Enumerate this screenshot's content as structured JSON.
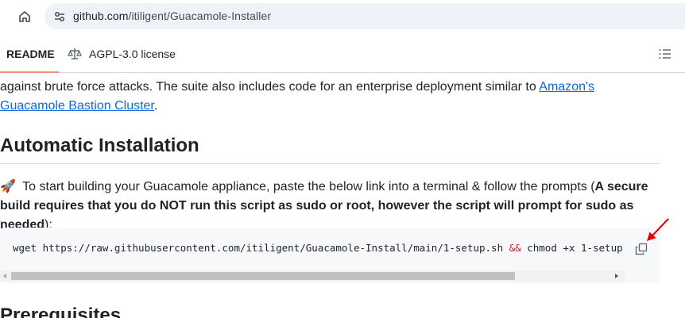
{
  "browser": {
    "url_host": "github.com",
    "url_path": "/itiligent/Guacamole-Installer",
    "home_icon": "home-icon",
    "site_info_icon": "tune-icon"
  },
  "tabs": {
    "readme_label": "README",
    "license_label": "AGPL-3.0 license",
    "license_icon": "law-scale-icon",
    "outline_icon": "list-outline-icon"
  },
  "content": {
    "intro_text": "against brute force attacks. The suite also includes code for an enterprise deployment similar to ",
    "intro_link": "Amazon's Guacamole Bastion Cluster",
    "intro_end": ".",
    "heading": "Automatic Installation",
    "instr_emoji": "🚀",
    "instr_text": " To start building your Guacamole appliance, paste the below link into a terminal & follow the prompts (",
    "instr_bold": "A secure build requires that you do NOT run this script as sudo or root, however the script will prompt for sudo as needed",
    "instr_end": "):",
    "code_part1": "wget https://raw.githubusercontent.com/itiligent/Guacamole-Install/main/1-setup.sh ",
    "code_op": "&&",
    "code_part2": " chmod +x 1-setup.",
    "copy_icon": "copy-icon",
    "next_heading": "Prerequisites"
  },
  "colors": {
    "link": "#0969da",
    "tab_accent": "#fd8c73",
    "annotation_arrow": "#e60000"
  }
}
